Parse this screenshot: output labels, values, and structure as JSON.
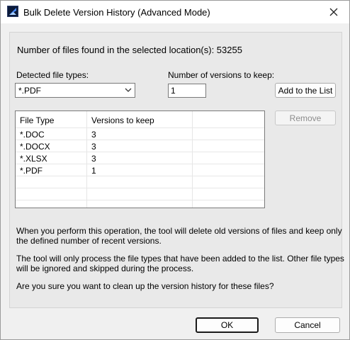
{
  "window": {
    "title": "Bulk Delete Version History (Advanced Mode)"
  },
  "summary": {
    "found_text": "Number of files found in the selected location(s): 53255"
  },
  "form": {
    "file_types_label": "Detected file types:",
    "file_type_selected": "*.PDF",
    "versions_label": "Number of versions to keep:",
    "versions_value": "1",
    "add_button": "Add to the List",
    "remove_button": "Remove"
  },
  "table": {
    "columns": [
      "File Type",
      "Versions to keep"
    ],
    "rows": [
      {
        "type": "*.DOC",
        "versions": "3"
      },
      {
        "type": "*.DOCX",
        "versions": "3"
      },
      {
        "type": "*.XLSX",
        "versions": "3"
      },
      {
        "type": "*.PDF",
        "versions": "1"
      }
    ]
  },
  "info": {
    "line1a": "When you perform this operation, the tool will delete old versions of files and keep only",
    "line1b": "the defined number of recent versions.",
    "line2a": "The tool will only process the file types that have been added to the list. Other file types",
    "line2b": "will be ignored and skipped during the process.",
    "line3": "Are you sure you want to clean up the version history for these files?"
  },
  "footer": {
    "ok_label": "OK",
    "cancel_label": "Cancel"
  }
}
